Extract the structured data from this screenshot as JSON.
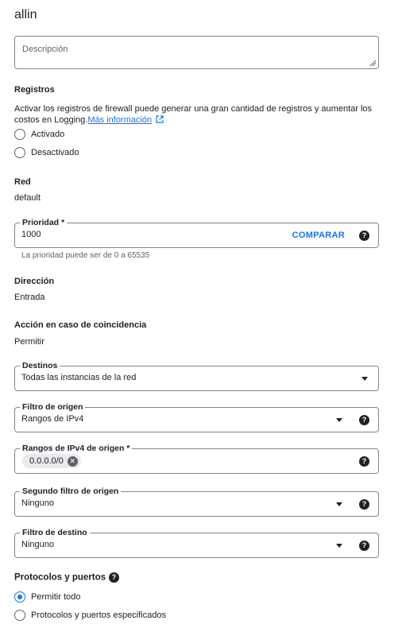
{
  "title": "allin",
  "description": {
    "placeholder": "Descripción"
  },
  "logs": {
    "label": "Registros",
    "text": "Activar los registros de firewall puede generar una gran cantidad de registros y aumentar los",
    "text2": "costos en Logging.",
    "link": "Más información",
    "options": [
      "Activado",
      "Desactivado"
    ],
    "selected": null
  },
  "network": {
    "label": "Red",
    "value": "default"
  },
  "priority": {
    "label": "Prioridad *",
    "value": "1000",
    "compare": "COMPARAR",
    "hint": "La prioridad puede ser de 0 a 65535"
  },
  "direction": {
    "label": "Dirección",
    "value": "Entrada"
  },
  "action": {
    "label": "Acción en caso de coincidencia",
    "value": "Permitir"
  },
  "targets": {
    "label": "Destinos",
    "value": "Todas las instancias de la red"
  },
  "source_filter": {
    "label": "Filtro de origen",
    "value": "Rangos de IPv4"
  },
  "source_ranges": {
    "label": "Rangos de IPv4 de origen *",
    "chip": "0.0.0.0/0"
  },
  "second_source_filter": {
    "label": "Segundo filtro de origen",
    "value": "Ninguno"
  },
  "dest_filter": {
    "label": "Filtro de destino",
    "value": "Ninguno"
  },
  "protocols": {
    "label": "Protocolos y puertos",
    "options": [
      "Permitir todo",
      "Protocolos y puertos especificados"
    ],
    "selected": "Permitir todo"
  },
  "icons": {
    "help": "help-icon",
    "external": "external-link-icon",
    "dropdown": "dropdown-caret-icon",
    "chip_remove": "cancel-icon"
  },
  "colors": {
    "accent": "#1a73e8",
    "text": "#202124",
    "muted": "#5f6368",
    "border": "#80868b"
  }
}
